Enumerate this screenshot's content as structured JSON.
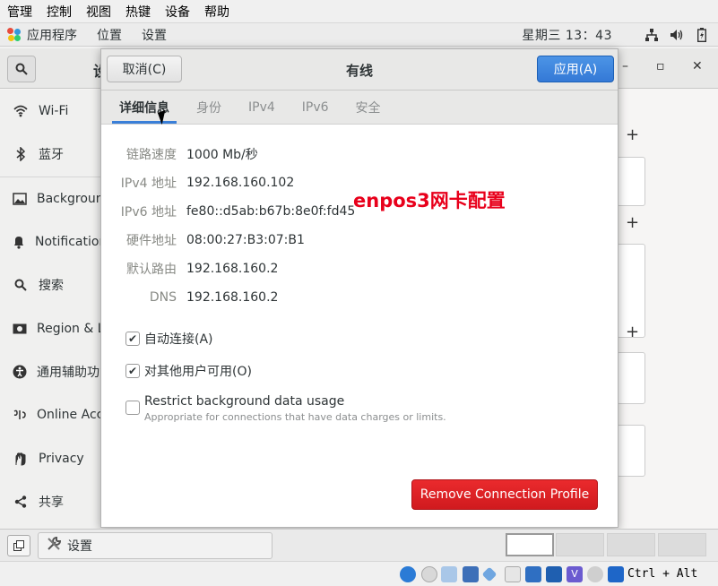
{
  "vbox_menu": [
    "管理",
    "控制",
    "视图",
    "热键",
    "设备",
    "帮助"
  ],
  "top_panel": {
    "apps": "应用程序",
    "places": "位置",
    "settings": "设置",
    "clock": "星期三 13：43"
  },
  "settings_window": {
    "header_partial": "设",
    "sidebar": [
      {
        "label": "Wi-Fi",
        "icon": "wifi-icon"
      },
      {
        "label": "蓝牙",
        "icon": "bluetooth-icon"
      },
      {
        "label": "Background",
        "icon": "background-icon"
      },
      {
        "label": "Notifications",
        "icon": "bell-icon"
      },
      {
        "label": "搜索",
        "icon": "search-icon"
      },
      {
        "label": "Region & Language",
        "icon": "region-icon"
      },
      {
        "label": "通用辅助功能",
        "icon": "accessibility-icon"
      },
      {
        "label": "Online Accounts",
        "icon": "online-accounts-icon"
      },
      {
        "label": "Privacy",
        "icon": "privacy-icon"
      },
      {
        "label": "共享",
        "icon": "share-icon"
      }
    ],
    "controls": {
      "minimize": "–",
      "maximize": "▫",
      "close": "✕"
    }
  },
  "dialog": {
    "cancel": "取消(C)",
    "title": "有线",
    "apply": "应用(A)",
    "tabs": [
      "详细信息",
      "身份",
      "IPv4",
      "IPv6",
      "安全"
    ],
    "active_tab": "详细信息",
    "details": [
      {
        "key": "链路速度",
        "value": "1000 Mb/秒"
      },
      {
        "key": "IPv4 地址",
        "value": "192.168.160.102"
      },
      {
        "key": "IPv6 地址",
        "value": "fe80::d5ab:b67b:8e0f:fd45"
      },
      {
        "key": "硬件地址",
        "value": "08:00:27:B3:07:B1"
      },
      {
        "key": "默认路由",
        "value": "192.168.160.2"
      },
      {
        "key": "DNS",
        "value": "192.168.160.2"
      }
    ],
    "annotation": "enpos3网卡配置",
    "checkboxes": [
      {
        "label": "自动连接(A)",
        "checked": true
      },
      {
        "label": "对其他用户可用(O)",
        "checked": true
      },
      {
        "label": "Restrict background data usage",
        "sub": "Appropriate for connections that have data charges or limits.",
        "checked": false
      }
    ],
    "remove": "Remove Connection Profile"
  },
  "taskbar": {
    "task": "设置"
  },
  "statusbar": {
    "hostkey": "Ctrl + Alt"
  },
  "colors": {
    "apply_blue": "#3479d6",
    "remove_red": "#d01a1e",
    "annotation_red": "#e8001b",
    "tab_accent": "#3a7fd8"
  }
}
